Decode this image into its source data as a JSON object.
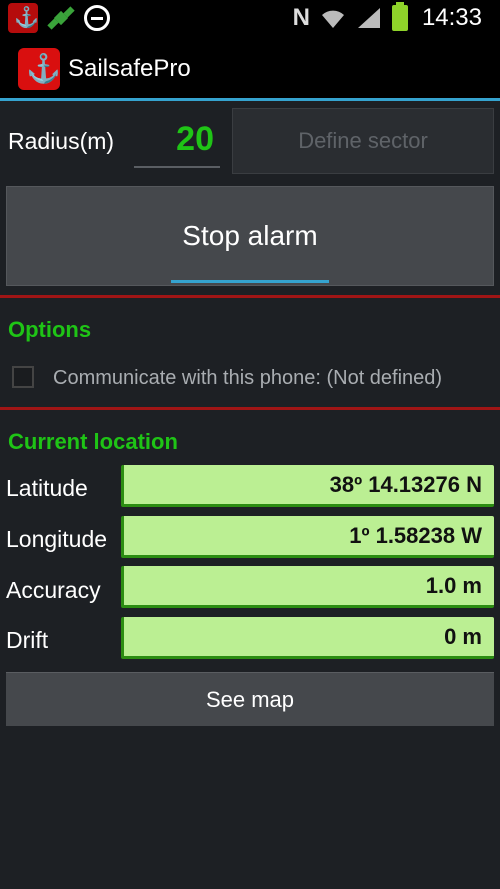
{
  "status_bar": {
    "time": "14:33",
    "network_letter": "N",
    "icons": [
      "sailsafe-notification-icon",
      "satellite-icon",
      "do-not-disturb-icon",
      "nfc-icon",
      "wifi-icon",
      "signal-icon",
      "battery-icon"
    ],
    "battery_color": "#8fd32a"
  },
  "action_bar": {
    "title": "SailsafePro",
    "accent_line_color": "#35a3cf"
  },
  "radius": {
    "label": "Radius(m)",
    "value": "20",
    "value_color": "#1fc416"
  },
  "define_sector": {
    "label": "Define sector"
  },
  "stop_alarm": {
    "label": "Stop alarm"
  },
  "options": {
    "title": "Options",
    "communicate_label": "Communicate with this phone: (Not defined)",
    "communicate_checked": false
  },
  "current_location": {
    "title": "Current location",
    "rows": [
      {
        "label": "Latitude",
        "value": "38º 14.13276 N"
      },
      {
        "label": "Longitude",
        "value": "1º 1.58238 W"
      },
      {
        "label": "Accuracy",
        "value": "1.0 m"
      },
      {
        "label": "Drift",
        "value": "0 m"
      }
    ]
  },
  "see_map": {
    "label": "See map"
  },
  "colors": {
    "section_title": "#1fc416",
    "divider_red": "#a01515",
    "field_background": "#bbef93"
  }
}
